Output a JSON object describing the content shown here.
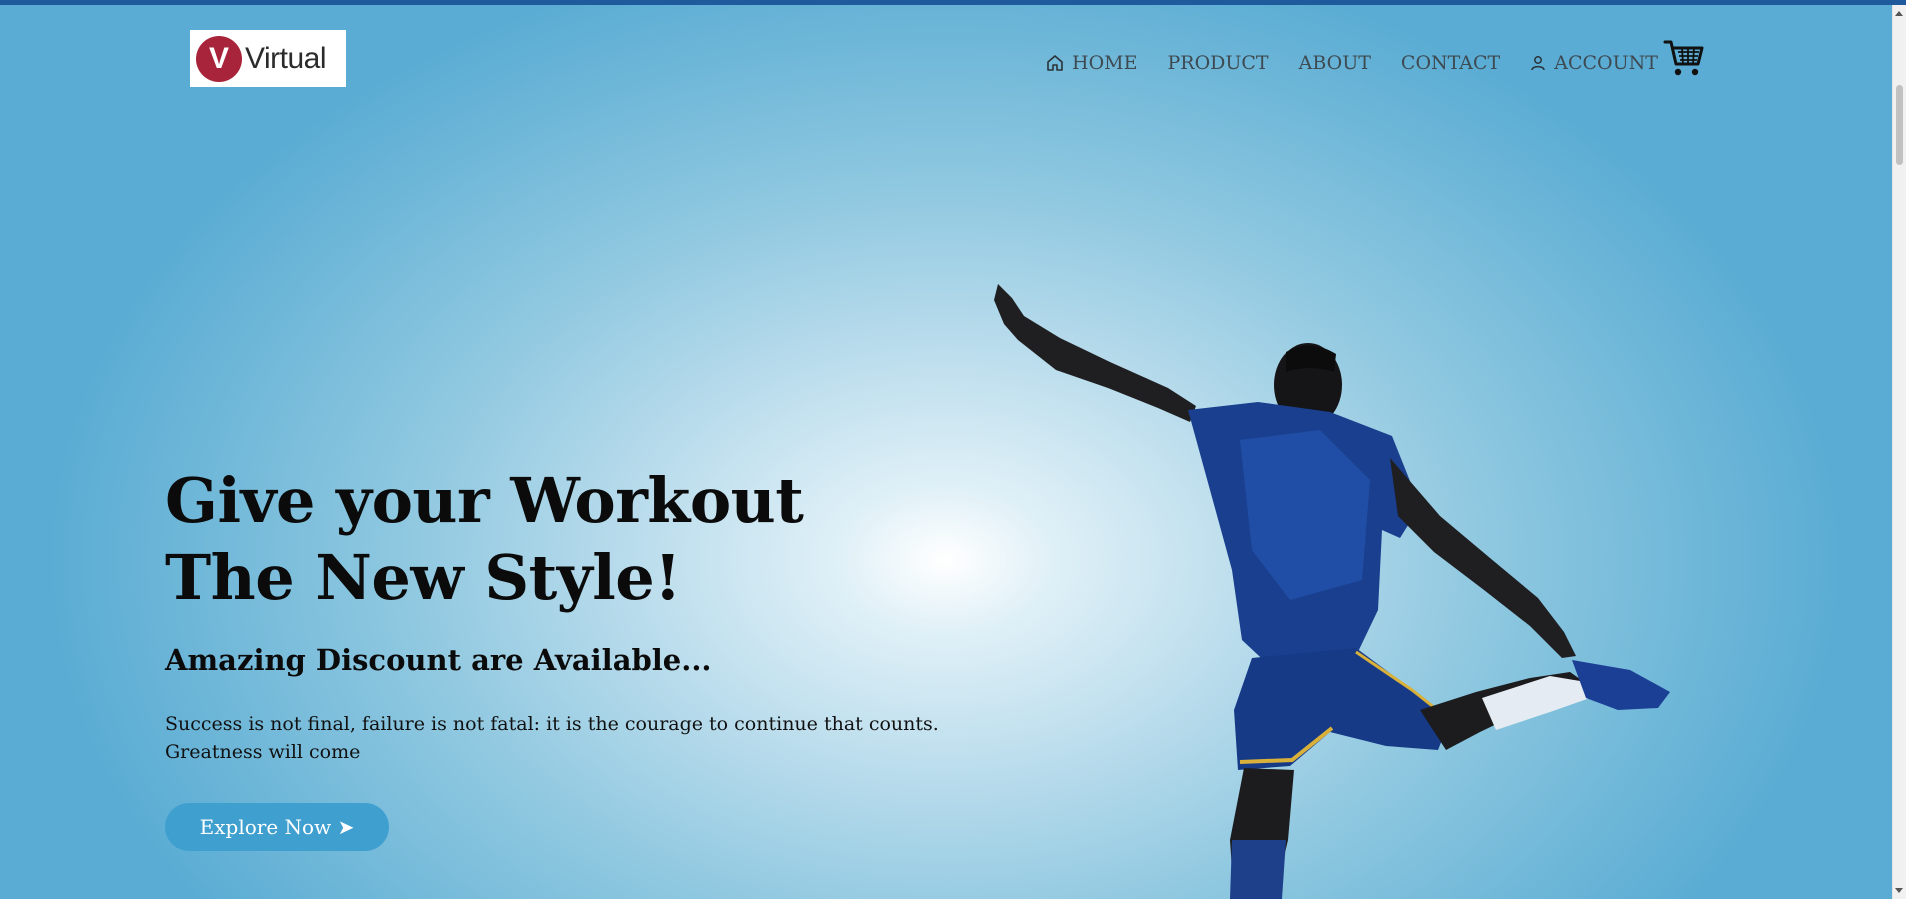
{
  "brand": {
    "logo_letter": "V",
    "logo_text": "Virtual",
    "accent": "#a7243a"
  },
  "nav": {
    "items": [
      {
        "label": "HOME",
        "icon": "home-icon"
      },
      {
        "label": "PRODUCT"
      },
      {
        "label": "ABOUT"
      },
      {
        "label": "CONTACT"
      },
      {
        "label": "ACCOUNT",
        "icon": "user-icon"
      }
    ],
    "cart_icon": "shopping-cart-icon"
  },
  "hero": {
    "title_line1": "Give your Workout",
    "title_line2": "The New Style!",
    "subtitle": "Amazing Discount are Available...",
    "quote_line1": "Success is not final, failure is not fatal: it is the courage to continue that counts.",
    "quote_line2": "Greatness will come",
    "cta_label": "Explore Now ➤",
    "cta_color": "#3f9fcf",
    "image_icon": "soccer-player-image"
  },
  "colors": {
    "top_strip": "#1e5a9c",
    "background_edge": "#5aacd4",
    "background_center": "#ffffff"
  }
}
